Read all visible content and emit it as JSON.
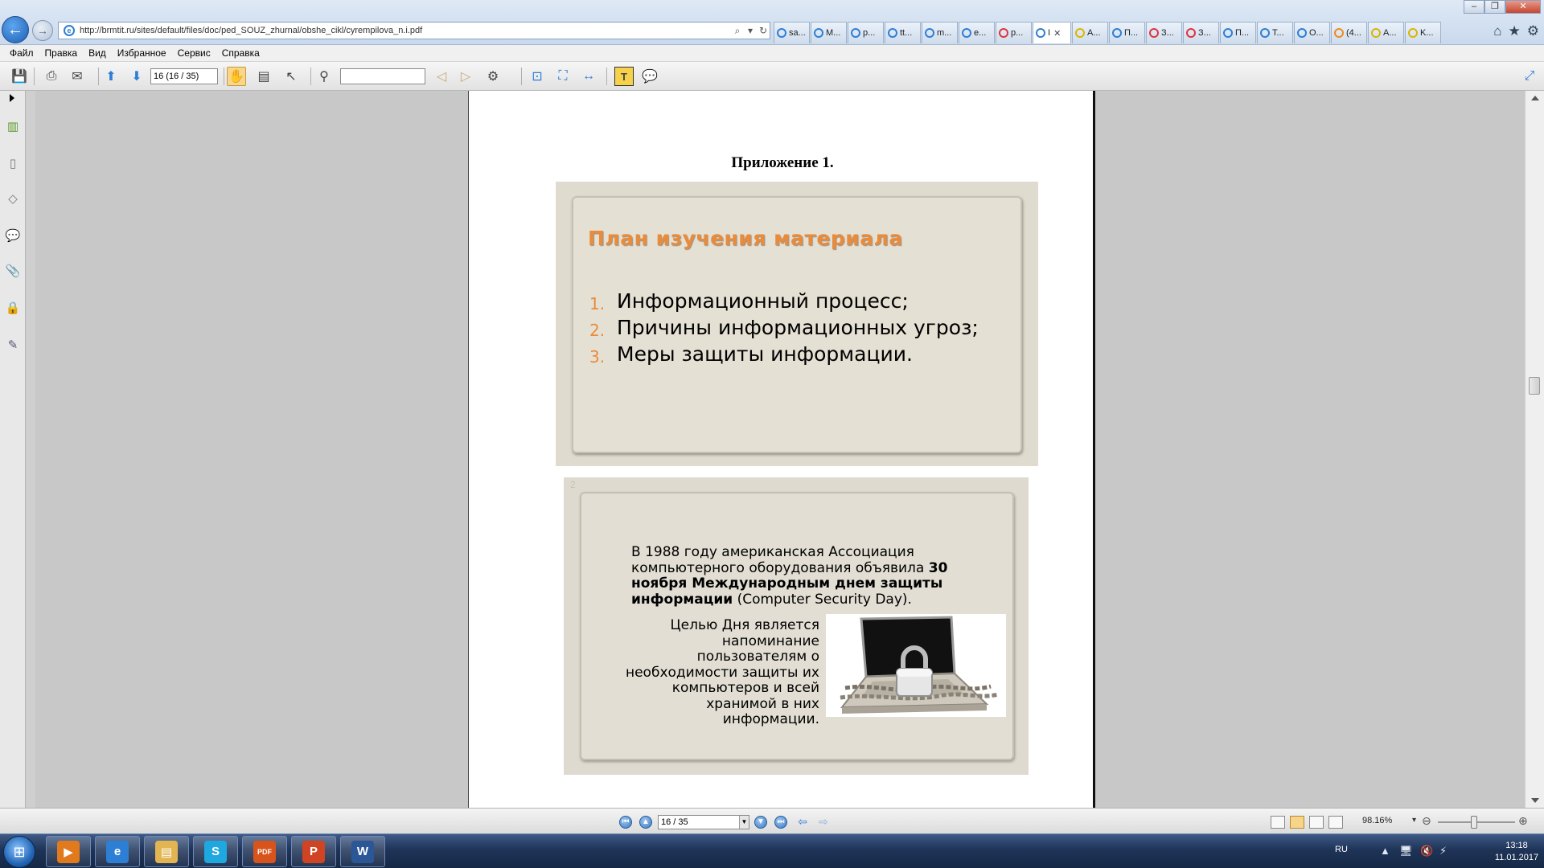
{
  "browser": {
    "window_title": "",
    "url": "http://brmtit.ru/sites/default/files/doc/ped_SOUZ_zhurnal/obshe_cikl/cyrempilova_n.i.pdf",
    "tabs": [
      {
        "label": "sa...",
        "color": "#2d7fd6"
      },
      {
        "label": "M...",
        "color": "#2d7fd6"
      },
      {
        "label": "p...",
        "color": "#2d7fd6"
      },
      {
        "label": "tt...",
        "color": "#2d7fd6"
      },
      {
        "label": "m...",
        "color": "#2d7fd6"
      },
      {
        "label": "e...",
        "color": "#2d7fd6"
      },
      {
        "label": "p...",
        "color": "#e0343d"
      },
      {
        "label": "I",
        "color": "#2d7fd6"
      },
      {
        "label": "A...",
        "color": "#d9b600"
      },
      {
        "label": "П...",
        "color": "#2d7fd6"
      },
      {
        "label": "З...",
        "color": "#e0343d"
      },
      {
        "label": "З...",
        "color": "#e0343d"
      },
      {
        "label": "П...",
        "color": "#2d7fd6"
      },
      {
        "label": "T...",
        "color": "#2d7fd6"
      },
      {
        "label": "O...",
        "color": "#2d7fd6"
      },
      {
        "label": "(4...",
        "color": "#ef8a1e"
      },
      {
        "label": "A...",
        "color": "#d9b600"
      },
      {
        "label": "K...",
        "color": "#d9b600"
      }
    ]
  },
  "menu": [
    "Файл",
    "Правка",
    "Вид",
    "Избранное",
    "Сервис",
    "Справка"
  ],
  "toolbar": {
    "page_field": "16 (16 / 35)",
    "find_placeholder": ""
  },
  "document": {
    "appendix_title": "Приложение 1.",
    "slide1": {
      "title": "План изучения материала",
      "items": [
        {
          "num": "1.",
          "text": "Информационный процесс;"
        },
        {
          "num": "2.",
          "text": "Причины информационных угроз;"
        },
        {
          "num": "3.",
          "text": "Меры защиты информации."
        }
      ]
    },
    "slide2": {
      "number": "2",
      "para_pre": "В 1988 году американская Ассоциация компьютерного оборудования объявила ",
      "para_bold": "30 ноября Международным днем защиты информации",
      "para_post": " (Computer Security Day).",
      "goal": "Целью Дня является напоминание пользователям о необходимости защиты их компьютеров и всей хранимой в них информации."
    }
  },
  "status": {
    "page": "16 / 35",
    "zoom": "98.16%"
  },
  "taskbar": {
    "items": [
      {
        "name": "media-player",
        "glyph": "▶",
        "color": "#e07a1c"
      },
      {
        "name": "internet-explorer",
        "glyph": "e",
        "color": "#2d7fd6"
      },
      {
        "name": "file-explorer",
        "glyph": "▤",
        "color": "#e2b552"
      },
      {
        "name": "skype",
        "glyph": "S",
        "color": "#1fa7e0"
      },
      {
        "name": "pdf-reader",
        "glyph": "PDF",
        "color": "#d8541c"
      },
      {
        "name": "powerpoint",
        "glyph": "P",
        "color": "#d04424"
      },
      {
        "name": "word",
        "glyph": "W",
        "color": "#2b5797"
      }
    ],
    "language": "RU",
    "time": "13:18",
    "date": "11.01.2017"
  }
}
